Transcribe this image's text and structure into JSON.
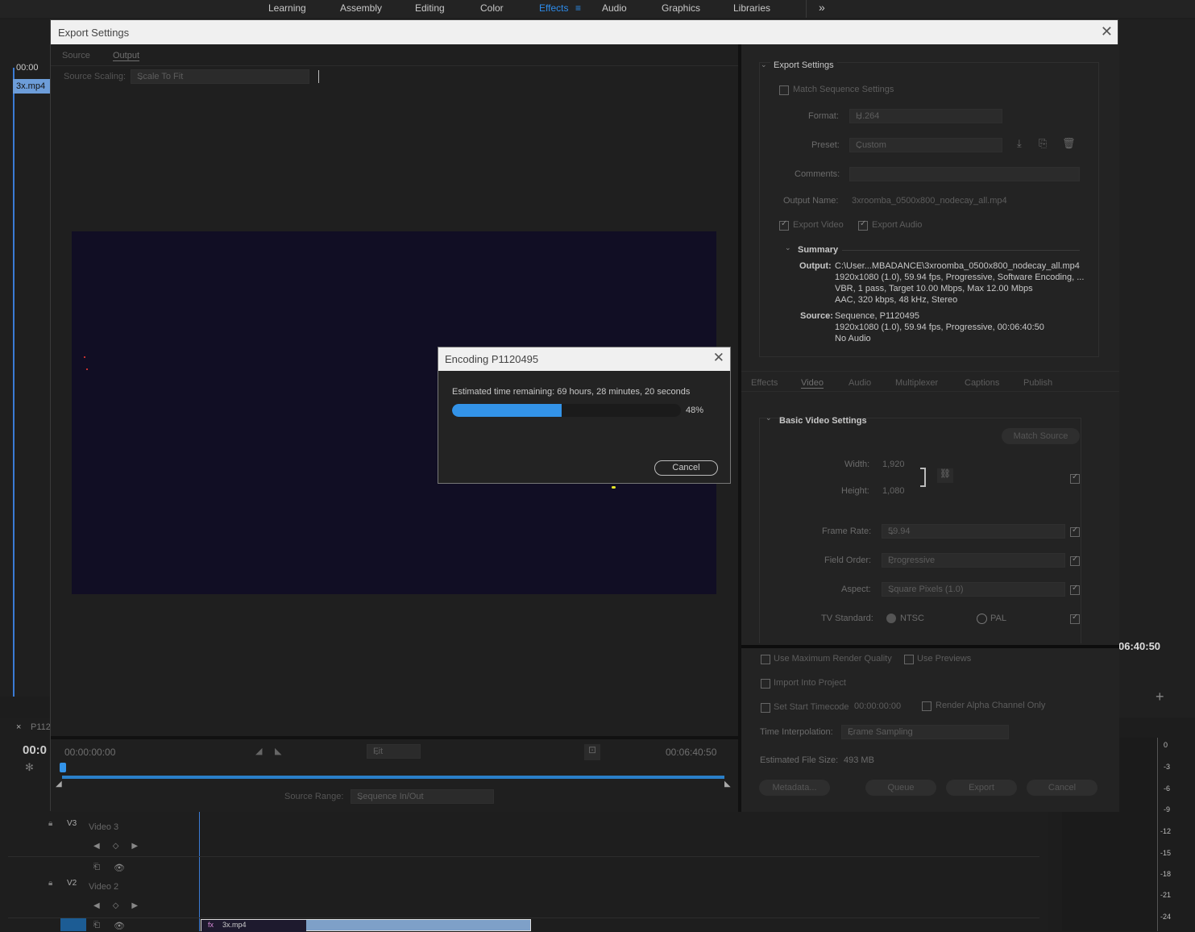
{
  "workspaces": [
    "Learning",
    "Assembly",
    "Editing",
    "Color",
    "Effects",
    "Audio",
    "Graphics",
    "Libraries"
  ],
  "active_workspace": "Effects",
  "background": {
    "timecode_top": "00:00",
    "clip_name": "3x.mp4",
    "seq_tab": "P112",
    "seq_timecode": "00:0",
    "program_timecode": "06:40:50",
    "track_v3": "V3",
    "track_v3_name": "Video 3",
    "track_v2": "V2",
    "track_v2_name": "Video 2",
    "timeline_clip": "3x.mp4",
    "meter_ticks": [
      "0",
      "-3",
      "-6",
      "-9",
      "-12",
      "-15",
      "-18",
      "-21",
      "-24"
    ]
  },
  "export": {
    "title": "Export Settings",
    "tabs": [
      "Source",
      "Output"
    ],
    "source_scaling_label": "Source Scaling:",
    "source_scaling_value": "Scale To Fit",
    "timecode_start": "00:00:00:00",
    "timecode_end": "00:06:40:50",
    "fit_value": "Fit",
    "source_range_label": "Source Range:",
    "source_range_value": "Sequence In/Out",
    "settings": {
      "title": "Export Settings",
      "match_sequence": "Match Sequence Settings",
      "format_label": "Format:",
      "format_value": "H.264",
      "preset_label": "Preset:",
      "preset_value": "Custom",
      "comments_label": "Comments:",
      "output_name_label": "Output Name:",
      "output_name_value": "3xroomba_0500x800_nodecay_all.mp4",
      "export_video": "Export Video",
      "export_audio": "Export Audio",
      "summary_title": "Summary",
      "output_label": "Output:",
      "output_lines": [
        "C:\\User...MBADANCE\\3xroomba_0500x800_nodecay_all.mp4",
        "1920x1080 (1.0), 59.94 fps, Progressive, Software Encoding, ...",
        "VBR, 1 pass, Target 10.00 Mbps, Max 12.00 Mbps",
        "AAC, 320 kbps, 48 kHz, Stereo"
      ],
      "source_label": "Source:",
      "source_lines": [
        "Sequence, P1120495",
        "1920x1080 (1.0), 59.94 fps, Progressive, 00:06:40:50",
        "No Audio"
      ]
    },
    "settings_tabs": [
      "Effects",
      "Video",
      "Audio",
      "Multiplexer",
      "Captions",
      "Publish"
    ],
    "video": {
      "title": "Basic Video Settings",
      "match_source": "Match Source",
      "width_label": "Width:",
      "width_value": "1,920",
      "height_label": "Height:",
      "height_value": "1,080",
      "frame_rate_label": "Frame Rate:",
      "frame_rate_value": "59.94",
      "field_order_label": "Field Order:",
      "field_order_value": "Progressive",
      "aspect_label": "Aspect:",
      "aspect_value": "Square Pixels (1.0)",
      "tv_standard_label": "TV Standard:",
      "ntsc": "NTSC",
      "pal": "PAL"
    },
    "bottom": {
      "max_render": "Use Maximum Render Quality",
      "use_previews": "Use Previews",
      "import_project": "Import Into Project",
      "set_start_tc": "Set Start Timecode",
      "start_tc_value": "00:00:00:00",
      "render_alpha": "Render Alpha Channel Only",
      "time_interp_label": "Time Interpolation:",
      "time_interp_value": "Frame Sampling",
      "est_size_label": "Estimated File Size:",
      "est_size_value": "493 MB",
      "metadata": "Metadata...",
      "queue": "Queue",
      "export": "Export",
      "cancel": "Cancel"
    }
  },
  "encoding": {
    "title": "Encoding P1120495",
    "message": "Estimated time remaining: 69 hours, 28 minutes, 20 seconds",
    "progress": 0.48,
    "progress_text": "48%",
    "cancel": "Cancel"
  }
}
